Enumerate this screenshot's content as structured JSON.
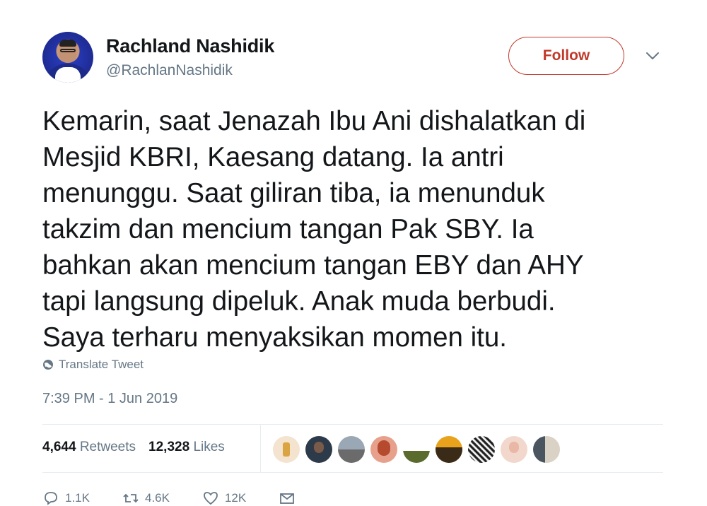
{
  "author": {
    "display_name": "Rachland Nashidik",
    "handle": "@RachlanNashidik",
    "avatar_icon": "profile-photo"
  },
  "follow_button": {
    "label": "Follow",
    "color": "#c0392b"
  },
  "tweet": {
    "text": "Kemarin, saat Jenazah Ibu Ani dishalatkan di\nMesjid KBRI, Kaesang datang. Ia antri\nmenunggu. Saat giliran tiba, ia menunduk\ntakzim dan mencium tangan Pak SBY. Ia\nbahkan akan mencium tangan EBY dan AHY\ntapi langsung dipeluk. Anak muda berbudi.\nSaya terharu menyaksikan momen itu.",
    "translate_label": "Translate Tweet",
    "timestamp": "7:39 PM - 1 Jun 2019"
  },
  "stats": {
    "retweets_count": "4,644",
    "retweets_label": "Retweets",
    "likes_count": "12,328",
    "likes_label": "Likes"
  },
  "actions": {
    "reply_count": "1.1K",
    "retweet_count": "4.6K",
    "like_count": "12K"
  },
  "colors": {
    "text": "#14171a",
    "muted": "#657786",
    "divider": "#e6ecf0",
    "accent": "#c0392b"
  }
}
